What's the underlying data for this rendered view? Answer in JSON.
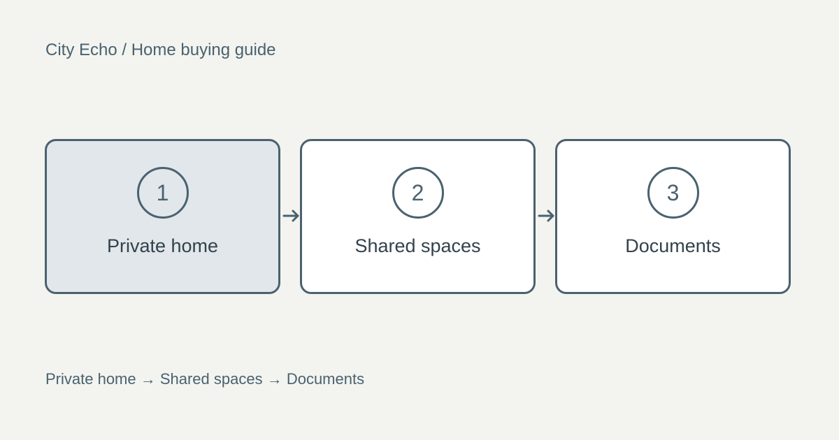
{
  "breadcrumb": {
    "text": "City Echo / Home buying guide"
  },
  "steps": [
    {
      "number": "1",
      "label": "Private home",
      "active": true
    },
    {
      "number": "2",
      "label": "Shared spaces",
      "active": false
    },
    {
      "number": "3",
      "label": "Documents",
      "active": false
    }
  ],
  "summary": {
    "text": "Private home → Shared spaces → Documents"
  },
  "colors": {
    "background": "#f3f4ef",
    "accent": "#4a6170",
    "active_fill": "#e1e7ea",
    "card_fill": "#ffffff",
    "label_text": "#33424c"
  },
  "icons": {
    "connector": "arrow-right-icon"
  }
}
